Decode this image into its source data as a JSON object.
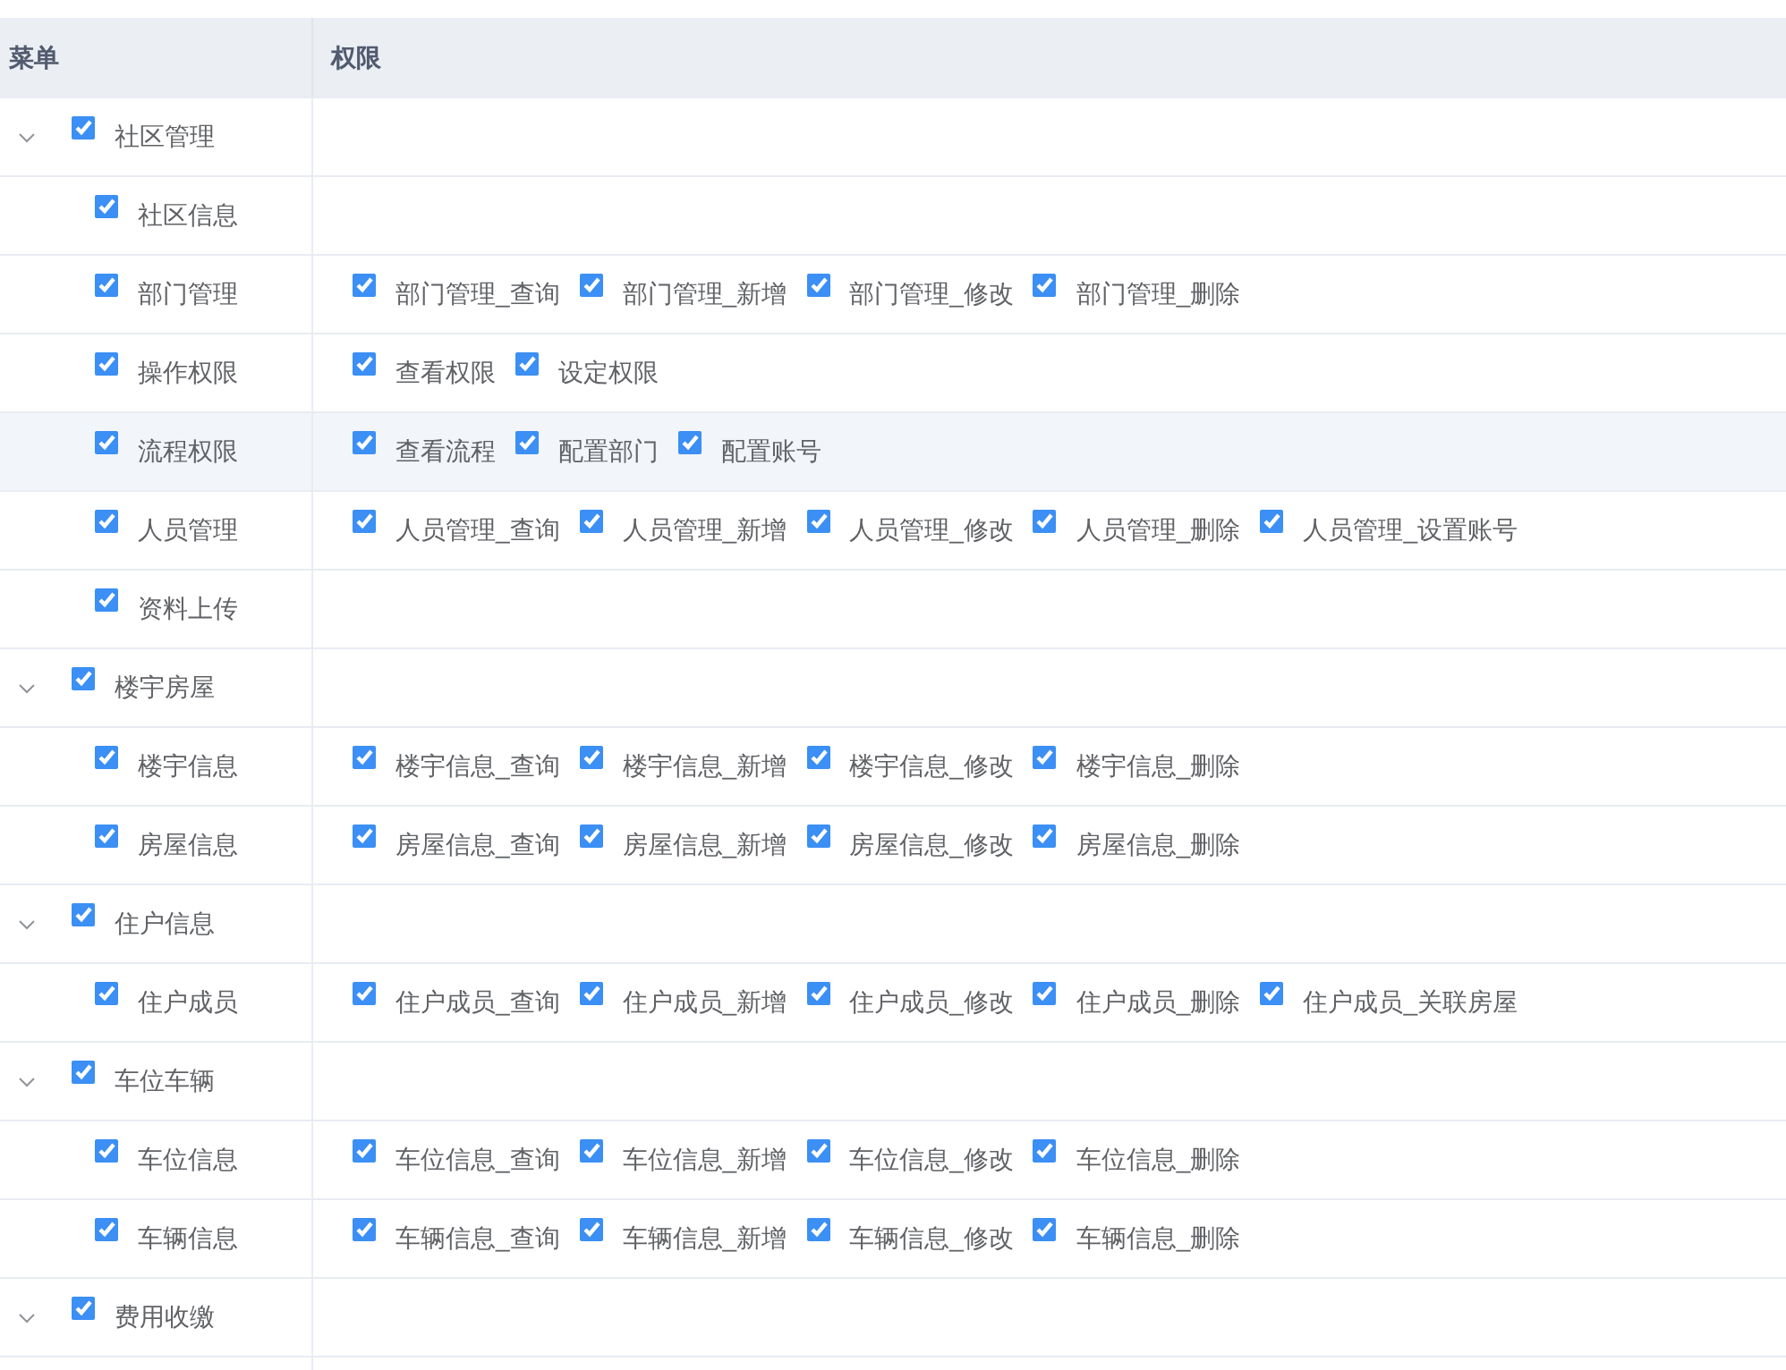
{
  "table": {
    "columns": [
      "菜单",
      "权限"
    ],
    "rows": [
      {
        "label": "社区管理",
        "checked": true,
        "expanded": true,
        "highlighted": false,
        "children": [
          {
            "label": "社区信息",
            "checked": true,
            "highlighted": false
          },
          {
            "label": "部门管理",
            "checked": true,
            "highlighted": false,
            "permissions": [
              {
                "label": "部门管理_查询",
                "checked": true
              },
              {
                "label": "部门管理_新增",
                "checked": true
              },
              {
                "label": "部门管理_修改",
                "checked": true
              },
              {
                "label": "部门管理_删除",
                "checked": true
              }
            ]
          },
          {
            "label": "操作权限",
            "checked": true,
            "highlighted": false,
            "permissions": [
              {
                "label": "查看权限",
                "checked": true
              },
              {
                "label": "设定权限",
                "checked": true
              }
            ]
          },
          {
            "label": "流程权限",
            "checked": true,
            "highlighted": true,
            "permissions": [
              {
                "label": "查看流程",
                "checked": true
              },
              {
                "label": "配置部门",
                "checked": true
              },
              {
                "label": "配置账号",
                "checked": true
              }
            ]
          },
          {
            "label": "人员管理",
            "checked": true,
            "highlighted": false,
            "permissions": [
              {
                "label": "人员管理_查询",
                "checked": true
              },
              {
                "label": "人员管理_新增",
                "checked": true
              },
              {
                "label": "人员管理_修改",
                "checked": true
              },
              {
                "label": "人员管理_删除",
                "checked": true
              },
              {
                "label": "人员管理_设置账号",
                "checked": true
              }
            ]
          },
          {
            "label": "资料上传",
            "checked": true,
            "highlighted": false
          }
        ]
      },
      {
        "label": "楼宇房屋",
        "checked": true,
        "expanded": true,
        "highlighted": false,
        "children": [
          {
            "label": "楼宇信息",
            "checked": true,
            "highlighted": false,
            "permissions": [
              {
                "label": "楼宇信息_查询",
                "checked": true
              },
              {
                "label": "楼宇信息_新增",
                "checked": true
              },
              {
                "label": "楼宇信息_修改",
                "checked": true
              },
              {
                "label": "楼宇信息_删除",
                "checked": true
              }
            ]
          },
          {
            "label": "房屋信息",
            "checked": true,
            "highlighted": false,
            "permissions": [
              {
                "label": "房屋信息_查询",
                "checked": true
              },
              {
                "label": "房屋信息_新增",
                "checked": true
              },
              {
                "label": "房屋信息_修改",
                "checked": true
              },
              {
                "label": "房屋信息_删除",
                "checked": true
              }
            ]
          }
        ]
      },
      {
        "label": "住户信息",
        "checked": true,
        "expanded": true,
        "highlighted": false,
        "children": [
          {
            "label": "住户成员",
            "checked": true,
            "highlighted": false,
            "permissions": [
              {
                "label": "住户成员_查询",
                "checked": true
              },
              {
                "label": "住户成员_新增",
                "checked": true
              },
              {
                "label": "住户成员_修改",
                "checked": true
              },
              {
                "label": "住户成员_删除",
                "checked": true
              },
              {
                "label": "住户成员_关联房屋",
                "checked": true
              }
            ]
          }
        ]
      },
      {
        "label": "车位车辆",
        "checked": true,
        "expanded": true,
        "highlighted": false,
        "children": [
          {
            "label": "车位信息",
            "checked": true,
            "highlighted": false,
            "permissions": [
              {
                "label": "车位信息_查询",
                "checked": true
              },
              {
                "label": "车位信息_新增",
                "checked": true
              },
              {
                "label": "车位信息_修改",
                "checked": true
              },
              {
                "label": "车位信息_删除",
                "checked": true
              }
            ]
          },
          {
            "label": "车辆信息",
            "checked": true,
            "highlighted": false,
            "permissions": [
              {
                "label": "车辆信息_查询",
                "checked": true
              },
              {
                "label": "车辆信息_新增",
                "checked": true
              },
              {
                "label": "车辆信息_修改",
                "checked": true
              },
              {
                "label": "车辆信息_删除",
                "checked": true
              }
            ]
          }
        ]
      },
      {
        "label": "费用收缴",
        "checked": true,
        "expanded": true,
        "highlighted": false
      }
    ]
  }
}
